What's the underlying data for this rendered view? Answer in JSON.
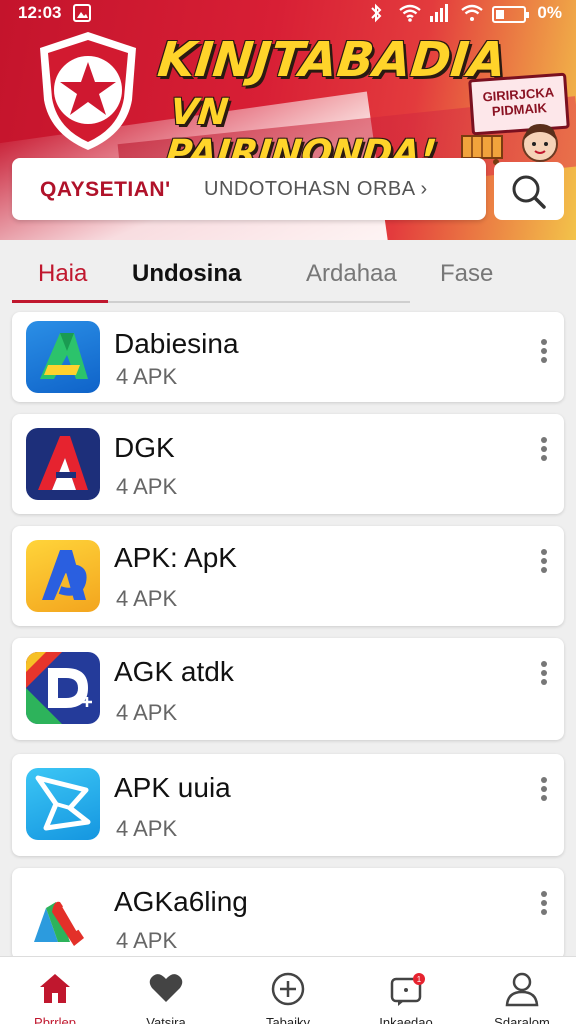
{
  "status_bar": {
    "time": "12:03",
    "battery_percent": "0%",
    "icons": [
      "gallery-icon",
      "bluetooth-icon",
      "wifi-icon",
      "signal-icon",
      "wifi-icon",
      "battery-icon"
    ]
  },
  "banner": {
    "title": "KINJTABADIA",
    "subtitle": "VN PAIRINONDA!",
    "promo_line1": "GIRIRJCKA",
    "promo_line2": "PIDMAIK"
  },
  "search": {
    "brand": "QAYSETIAN'",
    "placeholder": "UNDOTOHASN ORBA ›"
  },
  "tabs": [
    {
      "label": "Haia",
      "active": true
    },
    {
      "label": "Undosina",
      "active": false
    },
    {
      "label": "Ardahaa",
      "active": false
    },
    {
      "label": "Fase",
      "active": false
    }
  ],
  "apps": [
    {
      "name": "Dabiesina",
      "sub": "4 APK",
      "icon": "green-a-app-icon"
    },
    {
      "name": "DGK",
      "sub": "4 APK",
      "icon": "navy-a-app-icon"
    },
    {
      "name": "APK: ApK",
      "sub": "4 APK",
      "icon": "yellow-a-app-icon"
    },
    {
      "name": "AGK atdk",
      "sub": "4 APK",
      "icon": "blue-d-app-icon"
    },
    {
      "name": "APK uuia",
      "sub": "4 APK",
      "icon": "blue-fold-app-icon"
    },
    {
      "name": "AGKa6ling",
      "sub": "4 APK",
      "icon": "colorful-app-icon"
    }
  ],
  "bottom_nav": [
    {
      "label": "Pbrrlep",
      "icon": "home-icon",
      "active": true
    },
    {
      "label": "Vatsira",
      "icon": "heart-icon",
      "active": false
    },
    {
      "label": "Tabaiky",
      "icon": "plus-circle-icon",
      "active": false
    },
    {
      "label": "Inkaedao",
      "icon": "notification-icon",
      "active": false
    },
    {
      "label": "Sdaralom",
      "icon": "user-icon",
      "active": false
    }
  ],
  "colors": {
    "brand_red": "#c0172e",
    "banner_yellow": "#ffd42a"
  }
}
